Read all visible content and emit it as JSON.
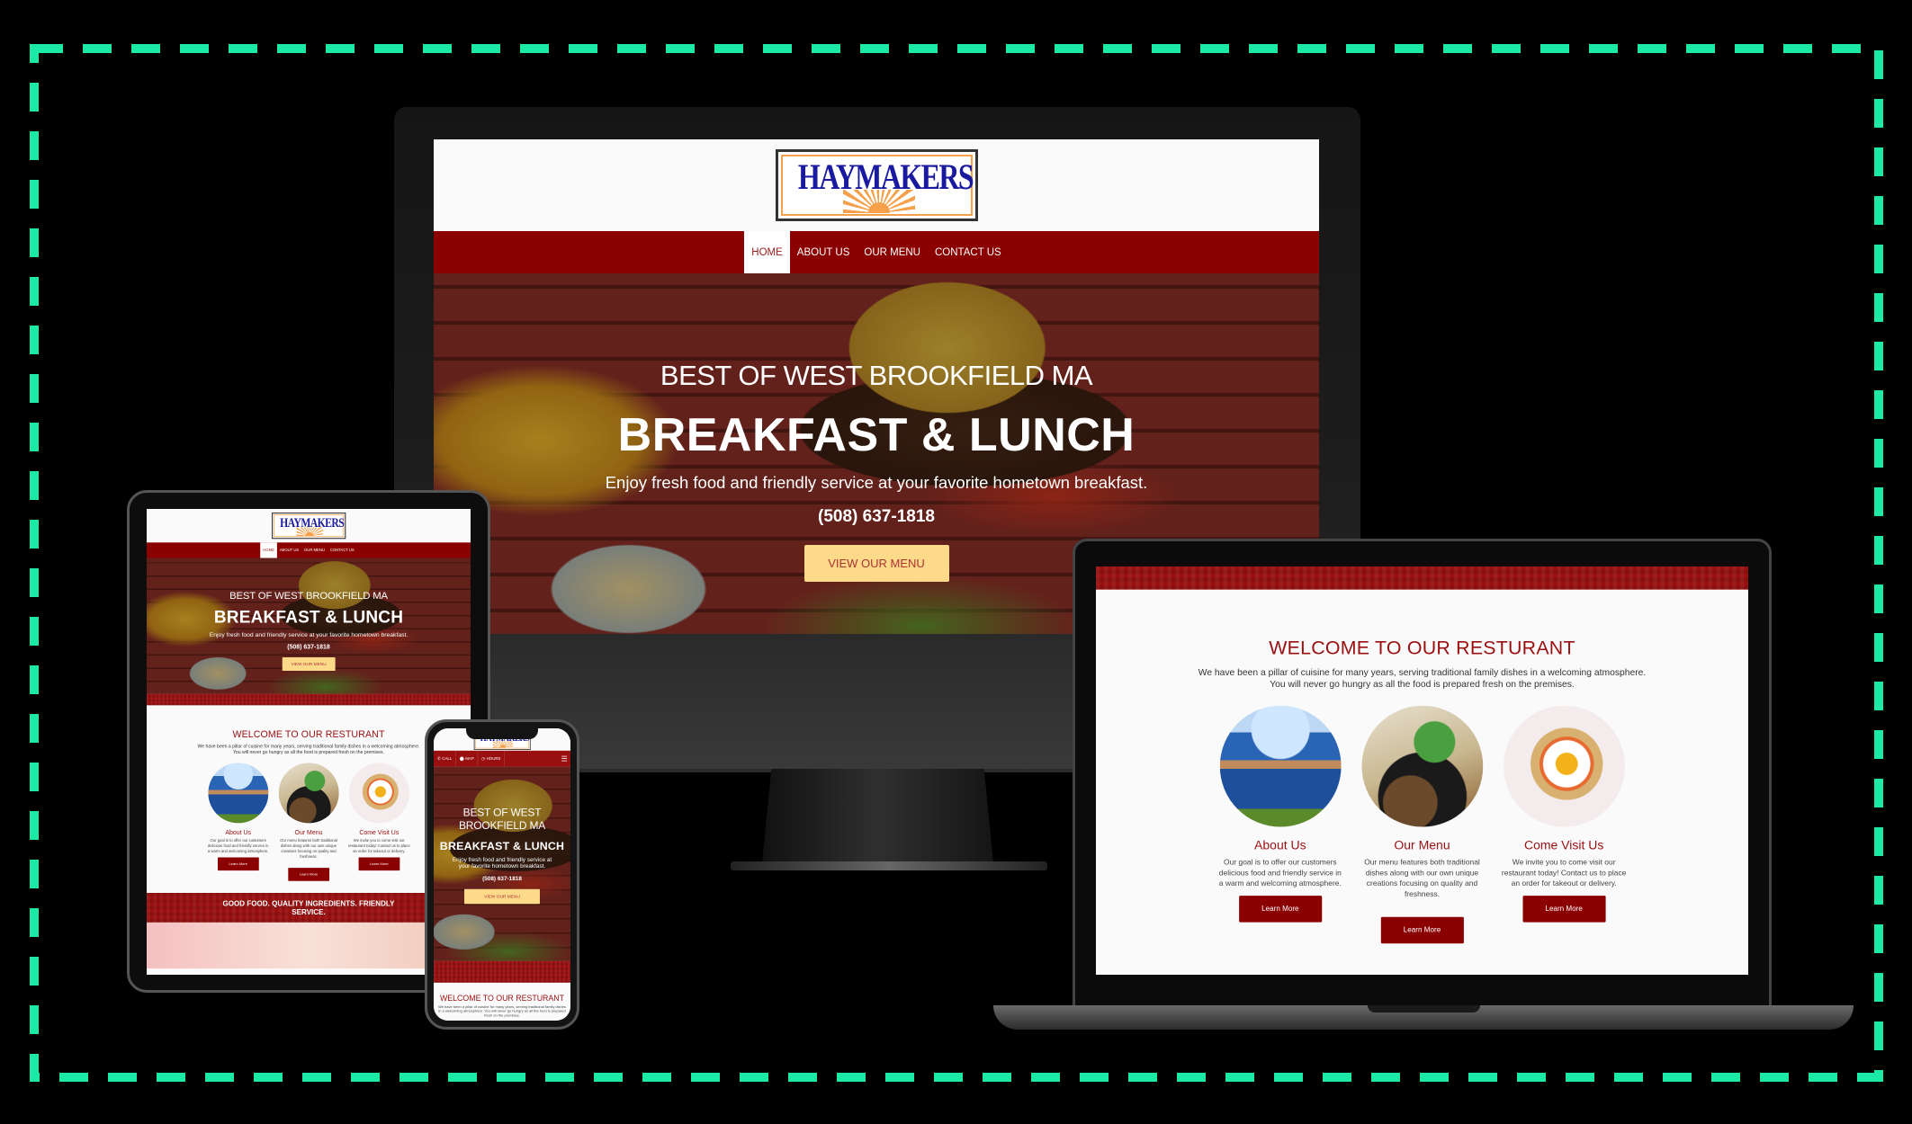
{
  "site": {
    "logo_text": "HAYMAKERS",
    "nav": [
      {
        "label": "HOME",
        "active": true
      },
      {
        "label": "ABOUT US"
      },
      {
        "label": "OUR MENU"
      },
      {
        "label": "CONTACT US"
      }
    ],
    "hero": {
      "kicker": "BEST OF WEST BROOKFIELD MA",
      "title": "BREAKFAST & LUNCH",
      "subtitle": "Enjoy fresh food and friendly service at your favorite hometown breakfast.",
      "phone": "(508) 637-1818",
      "cta": "VIEW OUR MENU"
    },
    "welcome": {
      "title": "WELCOME TO OUR RESTURANT",
      "intro": "We have been a pillar of cuisine for many years, serving traditional family dishes in a welcoming atmosphere. You will never go hungry as all the food is prepared fresh on the premises.",
      "cards": [
        {
          "title": "About Us",
          "text": "Our goal is to offer our customers delicious food and friendly service in a warm and welcoming atmosphere.",
          "button": "Learn More"
        },
        {
          "title": "Our Menu",
          "text": "Our menu features both traditional dishes along with our own unique creations focusing on quality and freshness.",
          "button": "Learn More"
        },
        {
          "title": "Come Visit Us",
          "text": "We invite you to come visit our restaurant today! Contact us to place an order for takeout or delivery.",
          "button": "Learn More"
        }
      ]
    },
    "footer_band": "GOOD FOOD. QUALITY INGREDIENTS. FRIENDLY SERVICE."
  },
  "mobile": {
    "actions": [
      {
        "label": "CALL",
        "icon": "phone-icon"
      },
      {
        "label": "MAP",
        "icon": "map-pin-icon"
      },
      {
        "label": "HOURS",
        "icon": "clock-icon"
      }
    ],
    "menu_icon": "hamburger-icon"
  },
  "colors": {
    "frame_dash": "#1de9a6",
    "brand_red": "#8b0000",
    "cta_yellow": "#fdd98a",
    "logo_blue": "#1a1aa0",
    "logo_orange": "#f5a04a"
  }
}
